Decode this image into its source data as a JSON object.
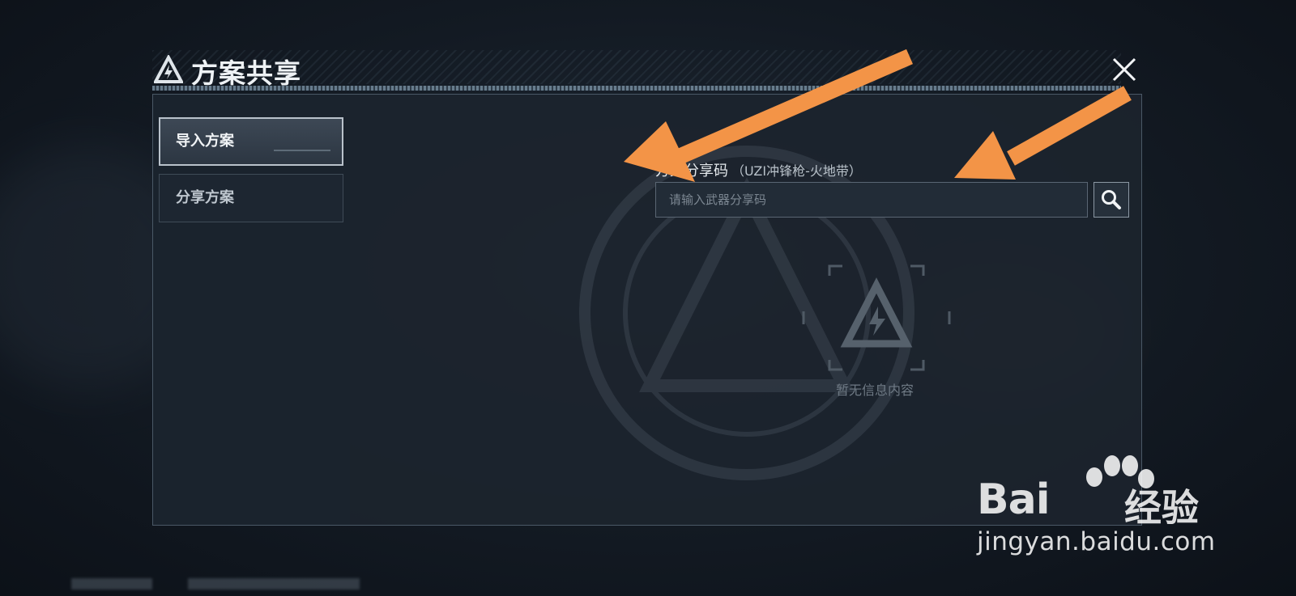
{
  "dialog": {
    "title": "方案共享",
    "close_icon": "close-icon"
  },
  "sidebar": {
    "items": [
      {
        "label": "导入方案",
        "active": true
      },
      {
        "label": "分享方案",
        "active": false
      }
    ]
  },
  "import": {
    "field_label": "方案分享码",
    "field_sub": "（UZI冲锋枪-火地带）",
    "input_value": "",
    "input_placeholder": "请输入武器分享码",
    "search_icon": "search-icon"
  },
  "empty_state": {
    "text": "暂无信息内容",
    "icon": "warning-logo-icon"
  },
  "annotations": {
    "arrow_color": "#f39447"
  },
  "watermark": {
    "brand": "Bai",
    "brand_tail": "经验",
    "url": "jingyan.baidu.com"
  },
  "colors": {
    "background": "#131a23",
    "panel": "#1c242e",
    "accent_border": "#b9c2cb"
  }
}
